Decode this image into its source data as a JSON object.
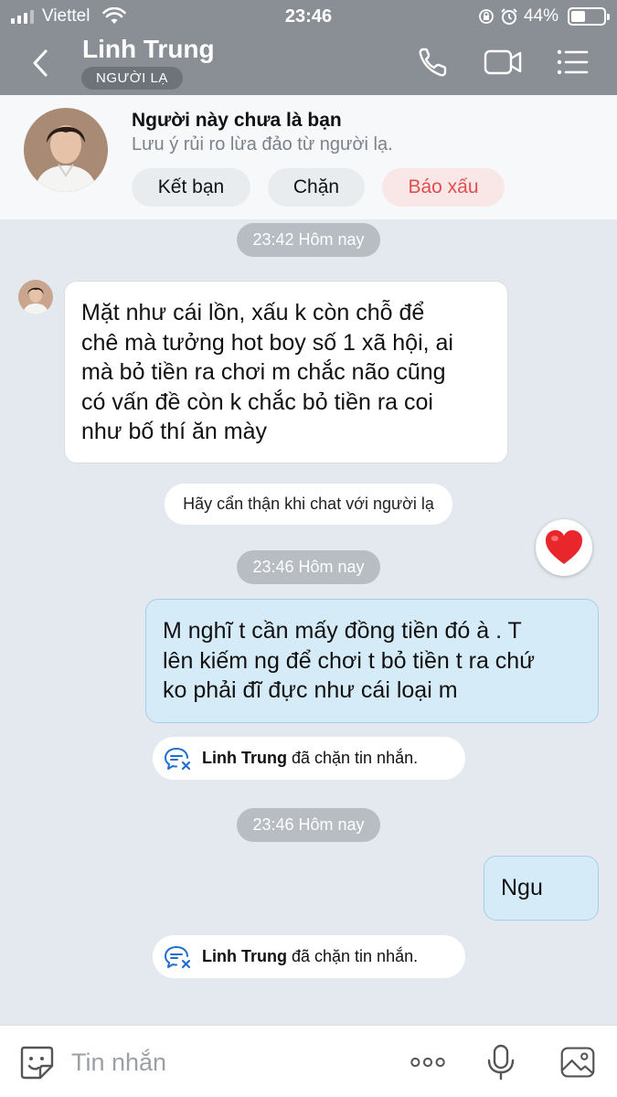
{
  "status_bar": {
    "carrier": "Viettel",
    "time": "23:46",
    "battery": "44%",
    "battery_level": 0.44
  },
  "header": {
    "name": "Linh Trung",
    "badge": "NGƯỜI LẠ",
    "icons": [
      "back-chevron-icon",
      "phone-icon",
      "video-call-icon",
      "menu-list-icon"
    ]
  },
  "stranger_panel": {
    "title": "Người này chưa là bạn",
    "subtitle": "Lưu ý rủi ro lừa đảo từ người lạ.",
    "buttons": {
      "add_friend": "Kết bạn",
      "block": "Chặn",
      "report": "Báo xấu"
    }
  },
  "conversation": {
    "timestamps": [
      "23:42 Hôm nay",
      "23:46 Hôm nay",
      "23:46 Hôm nay"
    ],
    "messages": [
      {
        "direction": "in",
        "lines": [
          "Mặt như cái lồn, xấu k còn chỗ để",
          "chê mà tưởng hot boy số 1 xã hội, ai",
          "mà bỏ tiền ra chơi m chắc não cũng",
          "có vấn đề còn k chắc bỏ tiền ra coi",
          "như bố thí ăn mày"
        ]
      },
      {
        "direction": "out",
        "lines": [
          "M nghĩ t cần mấy đồng tiền đó à . T",
          "lên kiếm ng để chơi t bỏ tiền t ra chứ",
          "ko phải đĩ đực như cái loại m"
        ],
        "reaction": "heart"
      },
      {
        "direction": "out",
        "lines": [
          "Ngu"
        ]
      }
    ],
    "caution_notice": "Hãy cẩn thận khi chat với người lạ",
    "blocked_notices": [
      {
        "name": "Linh Trung",
        "text": "đã chặn tin nhắn."
      },
      {
        "name": "Linh Trung",
        "text": "đã chặn tin nhắn."
      }
    ]
  },
  "input_bar": {
    "placeholder": "Tin nhắn",
    "icons": [
      "sticker-icon",
      "more-icon",
      "microphone-icon",
      "image-icon"
    ]
  },
  "colors": {
    "header_bg": "#8a8f96",
    "chat_bg": "#e4e9f0",
    "incoming_bubble": "#ffffff",
    "outgoing_bubble": "#d6ebf8",
    "report_red": "#e04e4e",
    "accent_blue": "#1f6fd0"
  }
}
